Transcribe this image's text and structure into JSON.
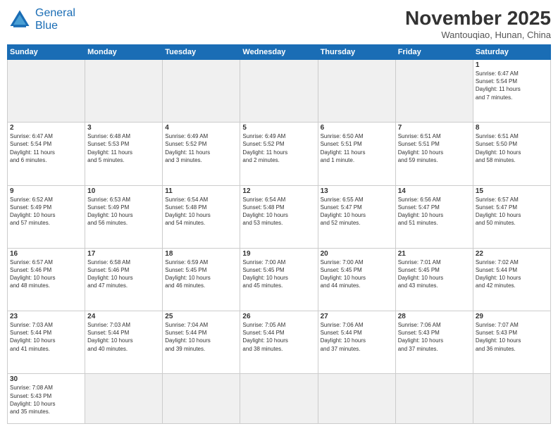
{
  "logo": {
    "line1": "General",
    "line2": "Blue"
  },
  "title": "November 2025",
  "subtitle": "Wantouqiao, Hunan, China",
  "days_of_week": [
    "Sunday",
    "Monday",
    "Tuesday",
    "Wednesday",
    "Thursday",
    "Friday",
    "Saturday"
  ],
  "weeks": [
    [
      {
        "num": "",
        "info": "",
        "empty": true
      },
      {
        "num": "",
        "info": "",
        "empty": true
      },
      {
        "num": "",
        "info": "",
        "empty": true
      },
      {
        "num": "",
        "info": "",
        "empty": true
      },
      {
        "num": "",
        "info": "",
        "empty": true
      },
      {
        "num": "",
        "info": "",
        "empty": true
      },
      {
        "num": "1",
        "info": "Sunrise: 6:47 AM\nSunset: 5:54 PM\nDaylight: 11 hours\nand 7 minutes."
      }
    ],
    [
      {
        "num": "2",
        "info": "Sunrise: 6:47 AM\nSunset: 5:54 PM\nDaylight: 11 hours\nand 6 minutes."
      },
      {
        "num": "3",
        "info": "Sunrise: 6:48 AM\nSunset: 5:53 PM\nDaylight: 11 hours\nand 5 minutes."
      },
      {
        "num": "4",
        "info": "Sunrise: 6:49 AM\nSunset: 5:52 PM\nDaylight: 11 hours\nand 3 minutes."
      },
      {
        "num": "5",
        "info": "Sunrise: 6:49 AM\nSunset: 5:52 PM\nDaylight: 11 hours\nand 2 minutes."
      },
      {
        "num": "6",
        "info": "Sunrise: 6:50 AM\nSunset: 5:51 PM\nDaylight: 11 hours\nand 1 minute."
      },
      {
        "num": "7",
        "info": "Sunrise: 6:51 AM\nSunset: 5:51 PM\nDaylight: 10 hours\nand 59 minutes."
      },
      {
        "num": "8",
        "info": "Sunrise: 6:51 AM\nSunset: 5:50 PM\nDaylight: 10 hours\nand 58 minutes."
      }
    ],
    [
      {
        "num": "9",
        "info": "Sunrise: 6:52 AM\nSunset: 5:49 PM\nDaylight: 10 hours\nand 57 minutes."
      },
      {
        "num": "10",
        "info": "Sunrise: 6:53 AM\nSunset: 5:49 PM\nDaylight: 10 hours\nand 56 minutes."
      },
      {
        "num": "11",
        "info": "Sunrise: 6:54 AM\nSunset: 5:48 PM\nDaylight: 10 hours\nand 54 minutes."
      },
      {
        "num": "12",
        "info": "Sunrise: 6:54 AM\nSunset: 5:48 PM\nDaylight: 10 hours\nand 53 minutes."
      },
      {
        "num": "13",
        "info": "Sunrise: 6:55 AM\nSunset: 5:47 PM\nDaylight: 10 hours\nand 52 minutes."
      },
      {
        "num": "14",
        "info": "Sunrise: 6:56 AM\nSunset: 5:47 PM\nDaylight: 10 hours\nand 51 minutes."
      },
      {
        "num": "15",
        "info": "Sunrise: 6:57 AM\nSunset: 5:47 PM\nDaylight: 10 hours\nand 50 minutes."
      }
    ],
    [
      {
        "num": "16",
        "info": "Sunrise: 6:57 AM\nSunset: 5:46 PM\nDaylight: 10 hours\nand 48 minutes."
      },
      {
        "num": "17",
        "info": "Sunrise: 6:58 AM\nSunset: 5:46 PM\nDaylight: 10 hours\nand 47 minutes."
      },
      {
        "num": "18",
        "info": "Sunrise: 6:59 AM\nSunset: 5:45 PM\nDaylight: 10 hours\nand 46 minutes."
      },
      {
        "num": "19",
        "info": "Sunrise: 7:00 AM\nSunset: 5:45 PM\nDaylight: 10 hours\nand 45 minutes."
      },
      {
        "num": "20",
        "info": "Sunrise: 7:00 AM\nSunset: 5:45 PM\nDaylight: 10 hours\nand 44 minutes."
      },
      {
        "num": "21",
        "info": "Sunrise: 7:01 AM\nSunset: 5:45 PM\nDaylight: 10 hours\nand 43 minutes."
      },
      {
        "num": "22",
        "info": "Sunrise: 7:02 AM\nSunset: 5:44 PM\nDaylight: 10 hours\nand 42 minutes."
      }
    ],
    [
      {
        "num": "23",
        "info": "Sunrise: 7:03 AM\nSunset: 5:44 PM\nDaylight: 10 hours\nand 41 minutes."
      },
      {
        "num": "24",
        "info": "Sunrise: 7:03 AM\nSunset: 5:44 PM\nDaylight: 10 hours\nand 40 minutes."
      },
      {
        "num": "25",
        "info": "Sunrise: 7:04 AM\nSunset: 5:44 PM\nDaylight: 10 hours\nand 39 minutes."
      },
      {
        "num": "26",
        "info": "Sunrise: 7:05 AM\nSunset: 5:44 PM\nDaylight: 10 hours\nand 38 minutes."
      },
      {
        "num": "27",
        "info": "Sunrise: 7:06 AM\nSunset: 5:44 PM\nDaylight: 10 hours\nand 37 minutes."
      },
      {
        "num": "28",
        "info": "Sunrise: 7:06 AM\nSunset: 5:43 PM\nDaylight: 10 hours\nand 37 minutes."
      },
      {
        "num": "29",
        "info": "Sunrise: 7:07 AM\nSunset: 5:43 PM\nDaylight: 10 hours\nand 36 minutes."
      }
    ],
    [
      {
        "num": "30",
        "info": "Sunrise: 7:08 AM\nSunset: 5:43 PM\nDaylight: 10 hours\nand 35 minutes.",
        "last": true
      },
      {
        "num": "",
        "info": "",
        "empty": true,
        "last": true
      },
      {
        "num": "",
        "info": "",
        "empty": true,
        "last": true
      },
      {
        "num": "",
        "info": "",
        "empty": true,
        "last": true
      },
      {
        "num": "",
        "info": "",
        "empty": true,
        "last": true
      },
      {
        "num": "",
        "info": "",
        "empty": true,
        "last": true
      },
      {
        "num": "",
        "info": "",
        "empty": true,
        "last": true
      }
    ]
  ]
}
